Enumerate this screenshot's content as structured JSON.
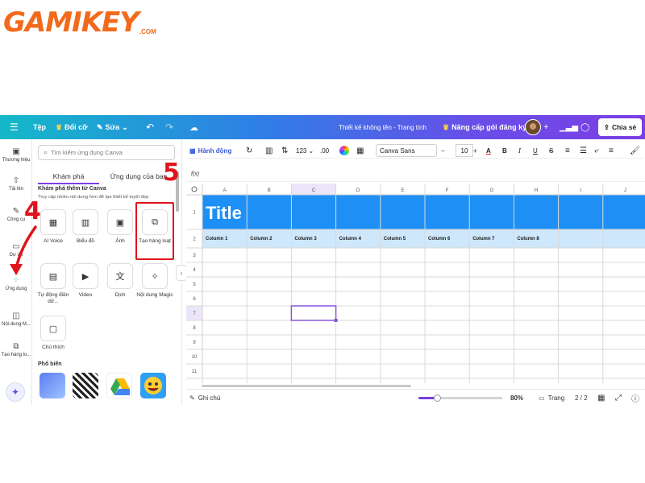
{
  "logo": {
    "main": "GAMIKEY",
    "suffix": ".COM"
  },
  "annotations": {
    "step4": "4",
    "step5": "5"
  },
  "topbar": {
    "file": "Tệp",
    "resize": "Đổi cỡ",
    "edit": "Sửa",
    "doc_title": "Thiết kế không tên - Trang tính",
    "upgrade": "Nâng cấp gói đăng ký",
    "share": "Chia sẻ",
    "plus": "+"
  },
  "rail": {
    "items": [
      {
        "label": "Thương hiệu",
        "icon": "briefcase-icon"
      },
      {
        "label": "Tải lên",
        "icon": "cloud-upload-icon"
      },
      {
        "label": "Công cụ",
        "icon": "pen-tool-icon"
      },
      {
        "label": "Dự án",
        "icon": "folder-icon"
      },
      {
        "label": "Ứng dụng",
        "icon": "apps-grid-icon"
      },
      {
        "label": "Nội dung M...",
        "icon": "magic-media-icon"
      },
      {
        "label": "Tạo hàng lo...",
        "icon": "bulk-create-icon"
      }
    ]
  },
  "panel": {
    "search_placeholder": "Tìm kiếm ứng dụng Canva",
    "tab_discover": "Khám phá",
    "tab_your_apps": "Ứng dụng của bạn",
    "section_title": "Khám phá thêm từ Canva",
    "section_desc": "Truy cập nhiều nội dung hơn để tạo thiết kế tuyệt đẹp",
    "apps": [
      {
        "label": "AI Voice",
        "glyph": "▦"
      },
      {
        "label": "Biểu đồ",
        "glyph": "▥"
      },
      {
        "label": "Ảnh",
        "glyph": "▣"
      },
      {
        "label": "Tạo hàng loạt",
        "glyph": "⧉"
      },
      {
        "label": "Tự động điền dữ...",
        "glyph": "▤"
      },
      {
        "label": "Video",
        "glyph": "▶"
      },
      {
        "label": "Dịch",
        "glyph": "文"
      },
      {
        "label": "Nội dung Magic",
        "glyph": "✧"
      },
      {
        "label": "Chú thích",
        "glyph": "▢"
      }
    ],
    "popular_title": "Phổ biến"
  },
  "format_toolbar": {
    "animate": "Hành động",
    "number_format": "123",
    "decimals": ".00",
    "font": "Canva Sans",
    "font_size": "10",
    "bold": "B",
    "italic": "I",
    "underline": "U",
    "strike": "S"
  },
  "formula": {
    "fx": "f(x)"
  },
  "sheet": {
    "columns": [
      "A",
      "B",
      "C",
      "D",
      "E",
      "F",
      "G",
      "H",
      "I",
      "J"
    ],
    "rows": [
      "1",
      "2",
      "3",
      "4",
      "5",
      "6",
      "7",
      "8",
      "9",
      "10",
      "11"
    ],
    "title": "Title",
    "headers": [
      "Column 1",
      "Column 2",
      "Column 3",
      "Column 4",
      "Column 5",
      "Column 6",
      "Column 7",
      "Column 8"
    ],
    "title_color": "#1e90f5",
    "header_color": "#cfe7fb",
    "selection_color": "#8a55d8",
    "selected_column": "C",
    "selected_row": "7"
  },
  "bottom": {
    "notes": "Ghi chú",
    "zoom": "80%",
    "zoom_fraction": 0.22,
    "page_label": "Trang",
    "page_count": "2 / 2"
  },
  "colors": {
    "brand": "#f26a1b",
    "accent": "#7b3fe4",
    "annotation": "#e0141b"
  }
}
